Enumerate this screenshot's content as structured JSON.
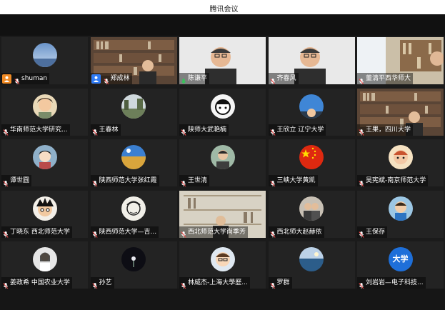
{
  "app": {
    "title": "腾讯会议"
  },
  "colors": {
    "background": "#1b1b1b",
    "active_speaker_border": "#34c759",
    "host_badge": "#f08a24",
    "cohost_badge": "#2f7bf5",
    "mic_muted": "#e84a4a"
  },
  "participants": [
    {
      "name": "shuman",
      "badge": "host",
      "mic": "muted",
      "avatar": "sky"
    },
    {
      "name": "郑成林",
      "badge": "cohost",
      "mic": "muted",
      "avatar": "video-bookshelf"
    },
    {
      "name": "陈谦平",
      "badge": "",
      "mic": "active",
      "avatar": "video-person",
      "active": true
    },
    {
      "name": "齐春风",
      "badge": "",
      "mic": "muted",
      "avatar": "video-person"
    },
    {
      "name": "董清平西华师大",
      "badge": "",
      "mic": "muted",
      "avatar": "video-room"
    },
    {
      "name": "华南师范大学研究...",
      "badge": "",
      "mic": "muted",
      "avatar": "cartoon"
    },
    {
      "name": "王春林",
      "badge": "",
      "mic": "muted",
      "avatar": "landscape"
    },
    {
      "name": "陕师大武艳楠",
      "badge": "",
      "mic": "muted",
      "avatar": "drawing"
    },
    {
      "name": "王欣立 辽宁大学",
      "badge": "",
      "mic": "muted",
      "avatar": "blue-sky"
    },
    {
      "name": "王果，四川大学",
      "badge": "",
      "mic": "muted",
      "avatar": "video-bookshelf"
    },
    {
      "name": "谭世圆",
      "badge": "",
      "mic": "muted",
      "avatar": "anime"
    },
    {
      "name": "陕西师范大学张红霞",
      "badge": "",
      "mic": "muted",
      "avatar": "field"
    },
    {
      "name": "王世清",
      "badge": "",
      "mic": "muted",
      "avatar": "person"
    },
    {
      "name": "三峡大学黄凯",
      "badge": "",
      "mic": "muted",
      "avatar": "flag"
    },
    {
      "name": "吴宪斌-南京师范大学",
      "badge": "",
      "mic": "muted",
      "avatar": "cartoon-kid"
    },
    {
      "name": "丁晓东 西北师范大学",
      "badge": "",
      "mic": "muted",
      "avatar": "anime-face"
    },
    {
      "name": "陕西师范大学—吉...",
      "badge": "",
      "mic": "muted",
      "avatar": "sketch"
    },
    {
      "name": "西北师范大学尚季芳",
      "badge": "",
      "mic": "muted",
      "avatar": "video-bookshelf-light"
    },
    {
      "name": "西北师大赵赫依",
      "badge": "",
      "mic": "muted",
      "avatar": "couple"
    },
    {
      "name": "王保存",
      "badge": "",
      "mic": "muted",
      "avatar": "child"
    },
    {
      "name": "姜政希 中国农业大学",
      "badge": "",
      "mic": "muted",
      "avatar": "portrait"
    },
    {
      "name": "孙艺",
      "badge": "",
      "mic": "muted",
      "avatar": "dark-flower"
    },
    {
      "name": "林威杰-上海大學歷...",
      "badge": "",
      "mic": "muted",
      "avatar": "cartoon-man"
    },
    {
      "name": "罗群",
      "badge": "",
      "mic": "muted",
      "avatar": "sea"
    },
    {
      "name": "刘岩岩—电子科技...",
      "badge": "",
      "mic": "muted",
      "avatar": "text-badge",
      "avatar_text": "大学"
    }
  ]
}
